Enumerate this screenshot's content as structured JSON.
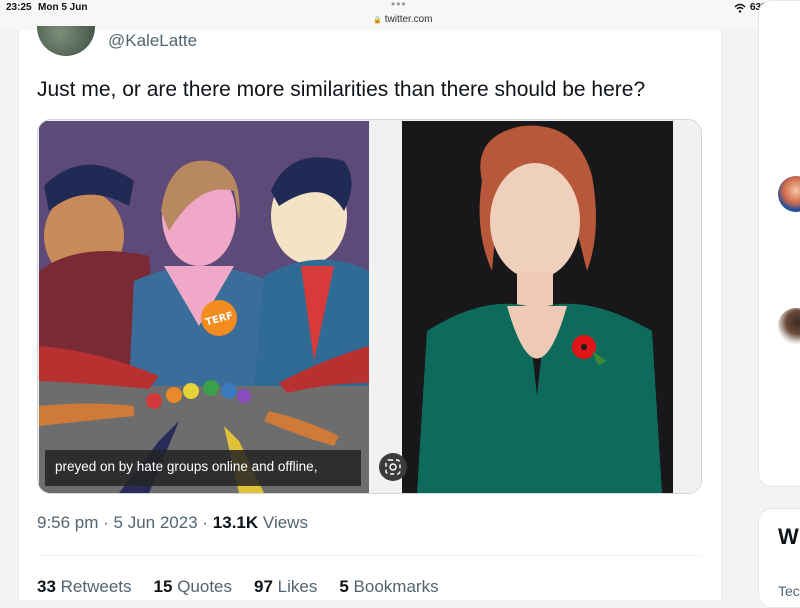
{
  "status": {
    "time": "23:25",
    "date": "Mon 5 Jun",
    "url": "twitter.com",
    "battery": "63%",
    "battery_level": 0.63
  },
  "tweet": {
    "handle": "@KaleLatte",
    "text": "Just me, or are there more similarities than there should be here?",
    "media": {
      "caption": "preyed on by hate groups online and offline,",
      "badge": "TERF"
    },
    "time": "9:56 pm",
    "date": "5 Jun 2023",
    "views_count": "13.1K",
    "views_label": "Views",
    "stats": [
      {
        "count": "33",
        "label": "Retweets"
      },
      {
        "count": "15",
        "label": "Quotes"
      },
      {
        "count": "97",
        "label": "Likes"
      },
      {
        "count": "5",
        "label": "Bookmarks"
      }
    ]
  },
  "sidebar": {
    "heading_fragment": "W",
    "text_fragment": "Tec"
  },
  "colors": {
    "accent_text": "#536471",
    "primary_text": "#0f1419",
    "poppy": "#e01515",
    "dress": "#0e6b5c"
  }
}
